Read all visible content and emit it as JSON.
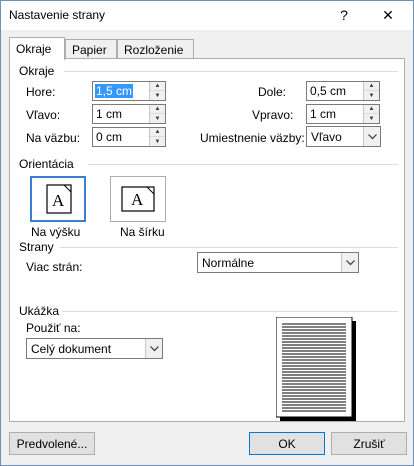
{
  "window": {
    "title": "Nastavenie strany",
    "help_label": "?",
    "close_label": "✕"
  },
  "tabs": [
    {
      "label": "Okraje",
      "active": true
    },
    {
      "label": "Papier",
      "active": false
    },
    {
      "label": "Rozloženie",
      "active": false
    }
  ],
  "margins": {
    "group_label": "Okraje",
    "top": {
      "label": "Hore:",
      "value": "1,5 cm"
    },
    "left": {
      "label": "Vľavo:",
      "value": "1 cm"
    },
    "gutter": {
      "label": "Na väzbu:",
      "value": "0 cm"
    },
    "bottom": {
      "label": "Dole:",
      "value": "0,5 cm"
    },
    "right": {
      "label": "Vpravo:",
      "value": "1 cm"
    },
    "gutter_position": {
      "label": "Umiestnenie väzby:",
      "value": "Vľavo"
    }
  },
  "orientation": {
    "group_label": "Orientácia",
    "portrait_label": "Na výšku",
    "landscape_label": "Na šírku",
    "icon_letter": "A",
    "selected": "portrait"
  },
  "pages": {
    "group_label": "Strany",
    "multiple_label": "Viac strán:",
    "multiple_value": "Normálne"
  },
  "preview": {
    "group_label": "Ukážka",
    "apply_label": "Použiť na:",
    "apply_value": "Celý dokument"
  },
  "buttons": {
    "default_label": "Predvolené...",
    "ok_label": "OK",
    "cancel_label": "Zrušiť"
  },
  "colors": {
    "accent": "#3c7fd0",
    "selection": "#3399ff"
  }
}
